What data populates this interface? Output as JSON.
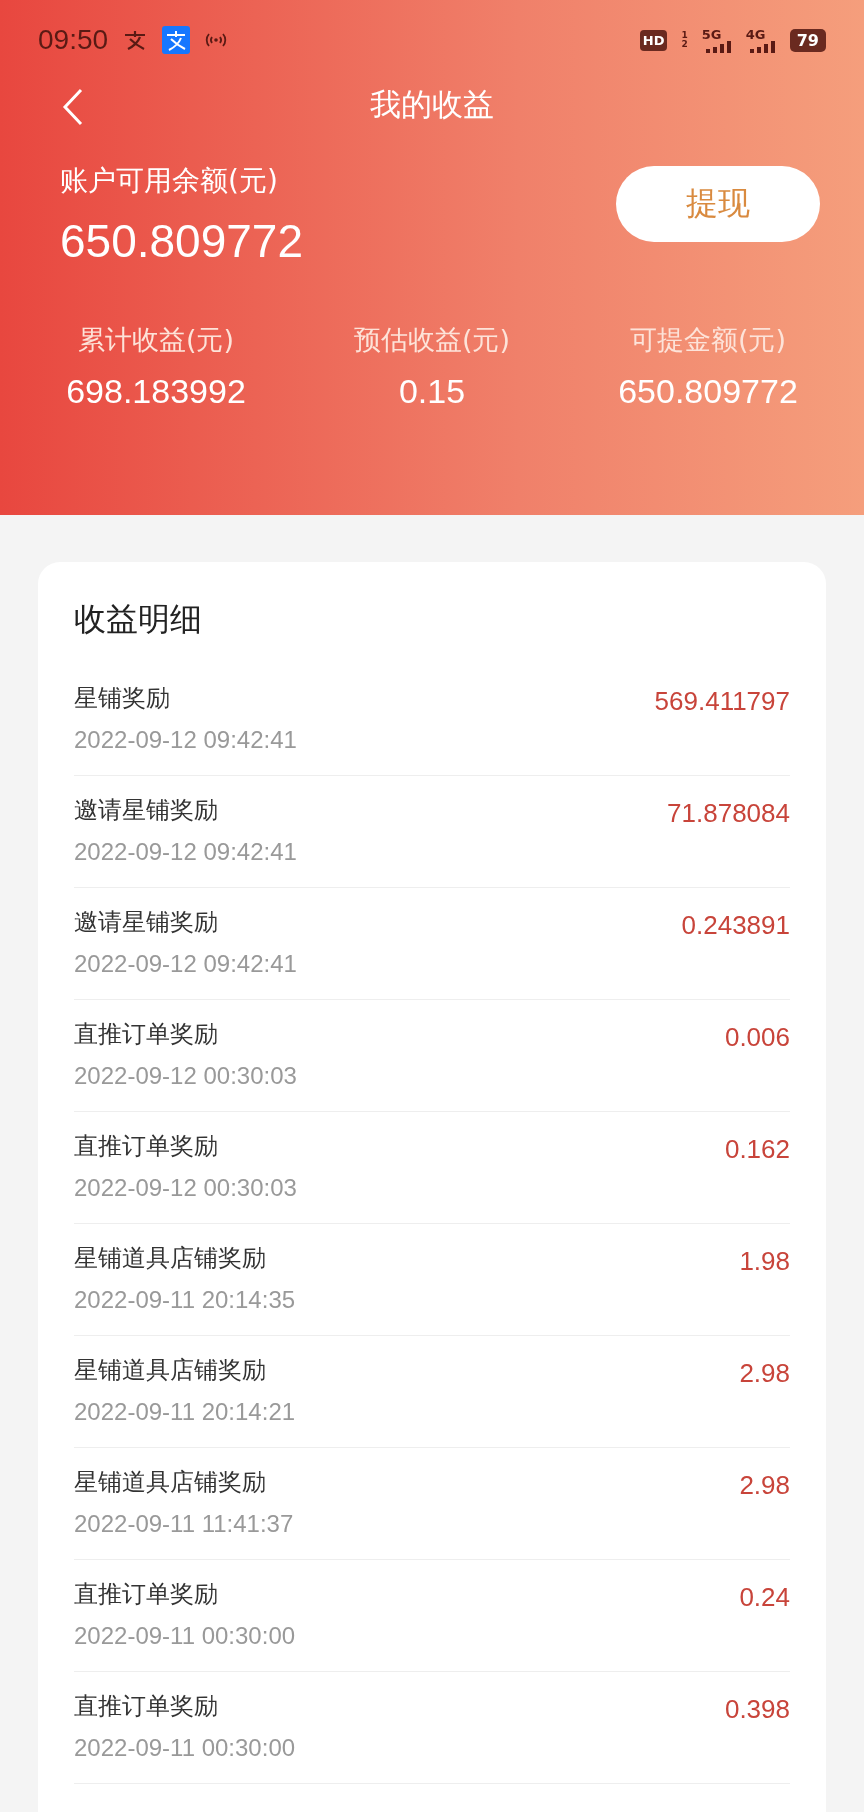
{
  "status_bar": {
    "time": "09:50",
    "hd": "HD",
    "sim_marks": [
      "1",
      "2"
    ],
    "networks": [
      "5G",
      "4G"
    ],
    "battery": "79"
  },
  "nav": {
    "title": "我的收益"
  },
  "balance": {
    "label": "账户可用余额(元)",
    "value": "650.809772",
    "button": "提现"
  },
  "stats": [
    {
      "label": "累计收益(元)",
      "value": "698.183992"
    },
    {
      "label": "预估收益(元)",
      "value": "0.15"
    },
    {
      "label": "可提金额(元)",
      "value": "650.809772"
    }
  ],
  "details": {
    "title": "收益明细",
    "rows": [
      {
        "name": "星铺奖励",
        "time": "2022-09-12 09:42:41",
        "amount": "569.411797"
      },
      {
        "name": "邀请星铺奖励",
        "time": "2022-09-12 09:42:41",
        "amount": "71.878084"
      },
      {
        "name": "邀请星铺奖励",
        "time": "2022-09-12 09:42:41",
        "amount": "0.243891"
      },
      {
        "name": "直推订单奖励",
        "time": "2022-09-12 00:30:03",
        "amount": "0.006"
      },
      {
        "name": "直推订单奖励",
        "time": "2022-09-12 00:30:03",
        "amount": "0.162"
      },
      {
        "name": "星铺道具店铺奖励",
        "time": "2022-09-11 20:14:35",
        "amount": "1.98"
      },
      {
        "name": "星铺道具店铺奖励",
        "time": "2022-09-11 20:14:21",
        "amount": "2.98"
      },
      {
        "name": "星铺道具店铺奖励",
        "time": "2022-09-11 11:41:37",
        "amount": "2.98"
      },
      {
        "name": "直推订单奖励",
        "time": "2022-09-11 00:30:00",
        "amount": "0.24"
      },
      {
        "name": "直推订单奖励",
        "time": "2022-09-11 00:30:00",
        "amount": "0.398"
      }
    ]
  }
}
